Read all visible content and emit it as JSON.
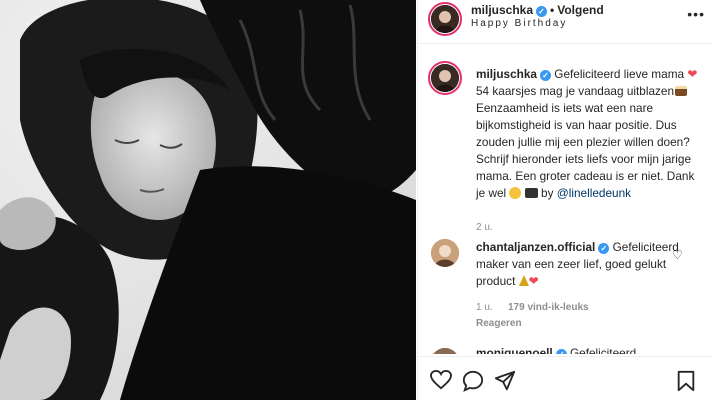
{
  "post": {
    "header": {
      "username": "miljuschka",
      "verified_icon": "verified-badge-icon",
      "separator": "•",
      "follow_label": "Volgend",
      "subtitle": "Happy Birthday",
      "more_icon": "more-options-icon"
    },
    "caption": {
      "username": "miljuschka",
      "text_1": "Gefeliciteerd lieve mama",
      "text_2": "54 kaarsjes mag je vandaag uitblazen",
      "text_3": "Eenzaamheid is iets wat een nare bijkomstigheid is van haar positie. Dus zouden jullie mij een plezier willen doen? Schrijf hieronder iets liefs voor mijn jarige mama. Een groter cadeau is er niet. Dank je wel",
      "text_by": "by",
      "mention": "@linelledeunk",
      "time": "2 u."
    },
    "comments": [
      {
        "username": "chantaljanzen.official",
        "text": "Gefeliciteerd maker van een zeer lief, goed gelukt product",
        "time": "1 u.",
        "likes": "179 vind-ik-leuks",
        "reply_label": "Reageren"
      },
      {
        "username": "moniquenoell",
        "text": "Gefeliciteerd"
      }
    ],
    "actions": {
      "like_icon": "heart-icon",
      "comment_icon": "comment-icon",
      "share_icon": "share-icon",
      "save_icon": "bookmark-icon"
    },
    "colors": {
      "verified": "#3897f0",
      "heart": "#ed4956",
      "link": "#003569",
      "story_ring": "#e1306c"
    }
  }
}
